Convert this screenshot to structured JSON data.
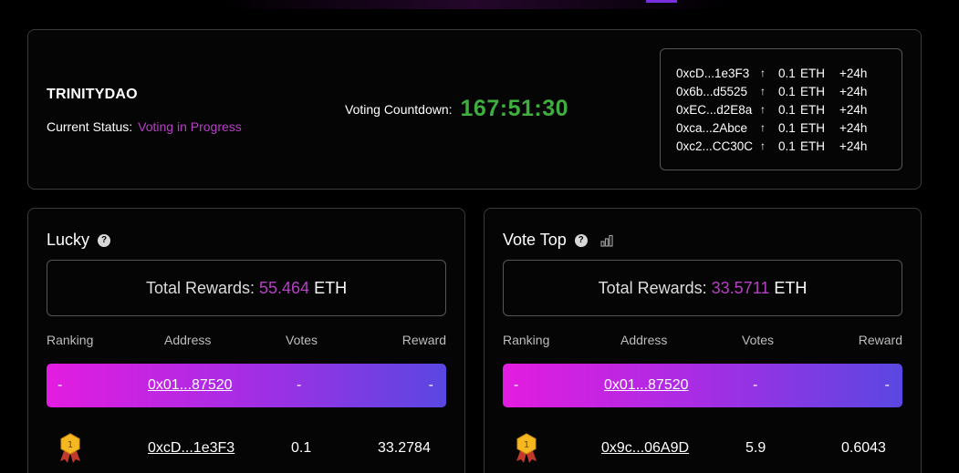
{
  "colors": {
    "accent_purple": "#b640c4",
    "countdown_green": "#3fae3f",
    "gradient_start": "#e31ce0",
    "gradient_end": "#5a47e2"
  },
  "status": {
    "dao_name": "TRINITYDAO",
    "status_label": "Current Status:",
    "status_value": "Voting in Progress",
    "countdown_label": "Voting Countdown:",
    "countdown_value": "167:51:30"
  },
  "transactions": [
    {
      "address": "0xcD...1e3F3",
      "arrow": "↑",
      "amount": "0.1",
      "unit": "ETH",
      "time": "+24h"
    },
    {
      "address": "0x6b...d5525",
      "arrow": "↑",
      "amount": "0.1",
      "unit": "ETH",
      "time": "+24h"
    },
    {
      "address": "0xEC...d2E8a",
      "arrow": "↑",
      "amount": "0.1",
      "unit": "ETH",
      "time": "+24h"
    },
    {
      "address": "0xca...2Abce",
      "arrow": "↑",
      "amount": "0.1",
      "unit": "ETH",
      "time": "+24h"
    },
    {
      "address": "0xc2...CC30C",
      "arrow": "↑",
      "amount": "0.1",
      "unit": "ETH",
      "time": "+24h"
    }
  ],
  "lucky": {
    "title": "Lucky",
    "help_icon": "question-circle-icon",
    "rewards_label": "Total Rewards:",
    "rewards_amount": "55.464",
    "rewards_unit": "ETH",
    "columns": {
      "ranking": "Ranking",
      "address": "Address",
      "votes": "Votes",
      "reward": "Reward"
    },
    "highlight": {
      "rank": "-",
      "address": "0x01...87520",
      "votes": "-",
      "reward": "-"
    },
    "rows": [
      {
        "rank_icon": "gold-medal-icon",
        "rank_number": "1",
        "address": "0xcD...1e3F3",
        "votes": "0.1",
        "reward": "33.2784"
      }
    ]
  },
  "votetop": {
    "title": "Vote Top",
    "help_icon": "question-circle-icon",
    "extra_icon": "bar-chart-icon",
    "rewards_label": "Total Rewards:",
    "rewards_amount": "33.5711",
    "rewards_unit": "ETH",
    "columns": {
      "ranking": "Ranking",
      "address": "Address",
      "votes": "Votes",
      "reward": "Reward"
    },
    "highlight": {
      "rank": "-",
      "address": "0x01...87520",
      "votes": "-",
      "reward": "-"
    },
    "rows": [
      {
        "rank_icon": "gold-medal-icon",
        "rank_number": "1",
        "address": "0x9c...06A9D",
        "votes": "5.9",
        "reward": "0.6043"
      }
    ]
  }
}
